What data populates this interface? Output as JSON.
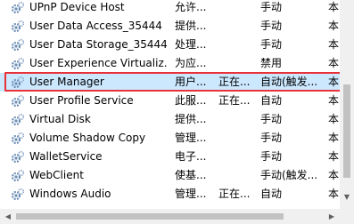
{
  "services": [
    {
      "name": "UPnP Device Host",
      "description": "允许...",
      "status": "",
      "startup_type": "手动",
      "logon": "本"
    },
    {
      "name": "User Data Access_35444",
      "description": "提供...",
      "status": "",
      "startup_type": "手动",
      "logon": "本"
    },
    {
      "name": "User Data Storage_35444",
      "description": "处理...",
      "status": "",
      "startup_type": "手动",
      "logon": "本"
    },
    {
      "name": "User Experience Virtualiz...",
      "description": "为应...",
      "status": "",
      "startup_type": "禁用",
      "logon": "本"
    },
    {
      "name": "User Manager",
      "description": "用户...",
      "status": "正在...",
      "startup_type": "自动(触发...",
      "logon": "本"
    },
    {
      "name": "User Profile Service",
      "description": "此服...",
      "status": "正在...",
      "startup_type": "自动",
      "logon": "本"
    },
    {
      "name": "Virtual Disk",
      "description": "提供...",
      "status": "",
      "startup_type": "手动",
      "logon": "本"
    },
    {
      "name": "Volume Shadow Copy",
      "description": "管理...",
      "status": "",
      "startup_type": "手动",
      "logon": "本"
    },
    {
      "name": "WalletService",
      "description": "电子...",
      "status": "",
      "startup_type": "手动",
      "logon": "本"
    },
    {
      "name": "WebClient",
      "description": "使基...",
      "status": "",
      "startup_type": "手动(触发...",
      "logon": "本"
    },
    {
      "name": "Windows Audio",
      "description": "管理...",
      "status": "正在...",
      "startup_type": "自动",
      "logon": "本"
    }
  ],
  "selected_index": 4,
  "colors": {
    "selection_background": "#cce8ff",
    "highlight_border": "#e8323a",
    "icon_gear": "#6d8fb5"
  },
  "icons": {
    "service": "gear-icon",
    "scroll_down": "arrow-down-icon",
    "scroll_left": "arrow-left-icon",
    "scroll_right": "arrow-right-icon"
  }
}
